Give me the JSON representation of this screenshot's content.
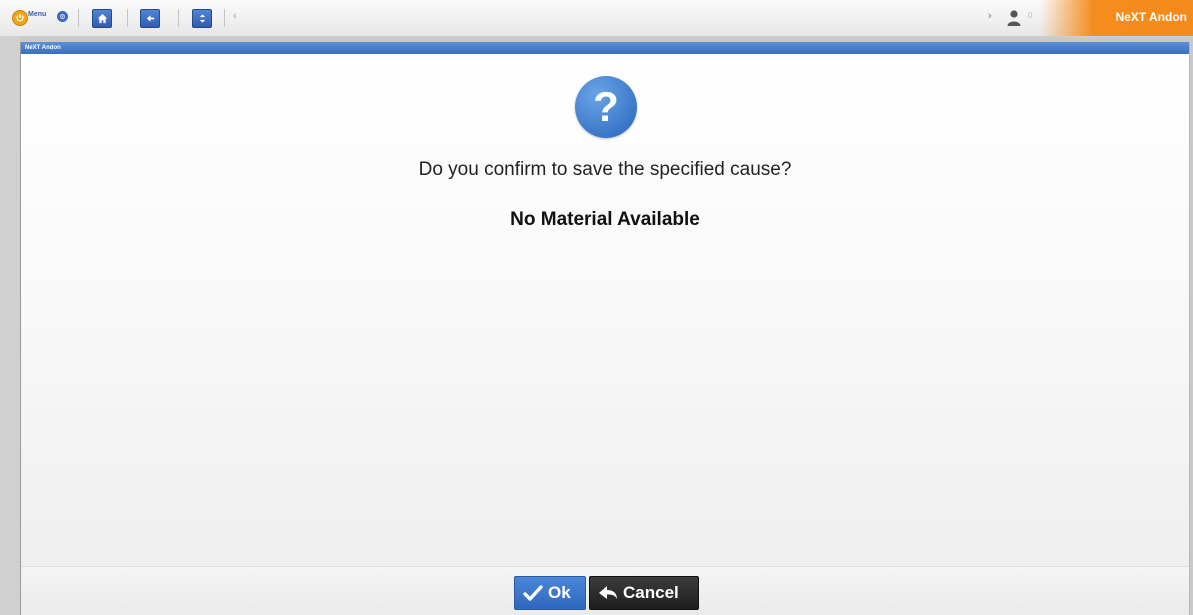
{
  "toolbar": {
    "menu_label": "Menu",
    "scroll_left": "‹",
    "scroll_right": "›",
    "user_count": "0",
    "brand": "NeXT Andon",
    "brand_color": "#f58c1e",
    "icons": [
      "power-icon",
      "gear-icon",
      "home-icon",
      "back-arrow-icon",
      "swap-icon",
      "user-icon"
    ]
  },
  "dialog": {
    "title": "NeXT Andon",
    "icon": "question-icon",
    "icon_glyph": "?",
    "question": "Do you confirm to save the specified cause?",
    "cause": "No Material Available",
    "ok_label": "Ok",
    "cancel_label": "Cancel",
    "accent_color": "#3b77c9"
  }
}
